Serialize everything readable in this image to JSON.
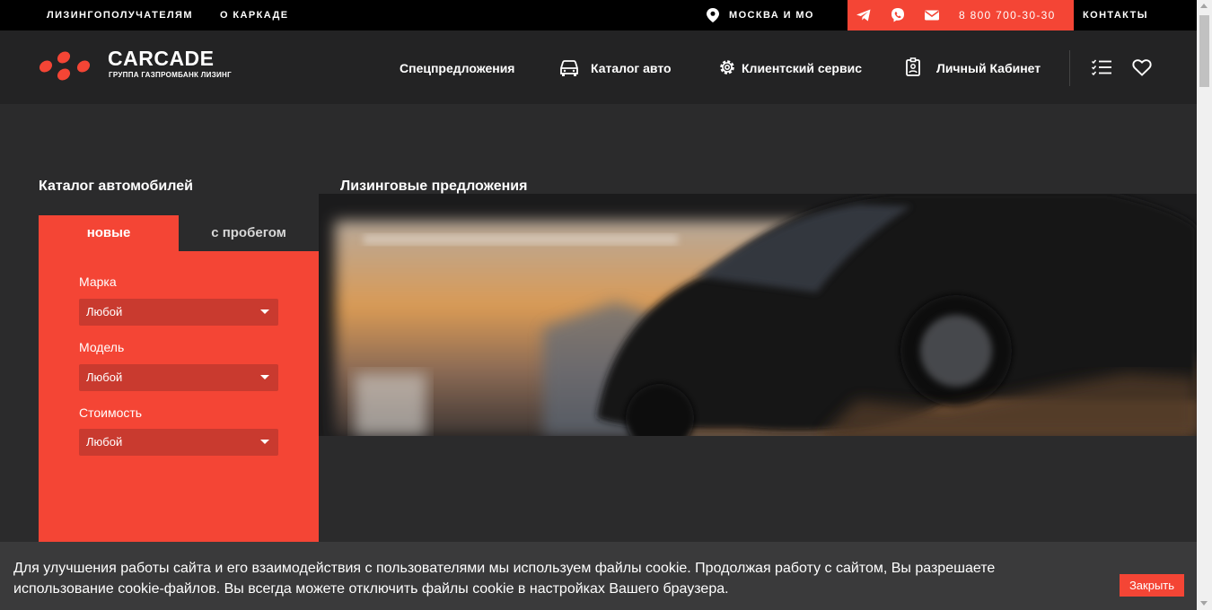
{
  "topbar": {
    "links": [
      "ЛИЗИНГОПОЛУЧАТЕЛЯМ",
      "О КАРКАДЕ"
    ],
    "city": "МОСКВА И МО",
    "phone": "8 800 700-30-30",
    "contacts": "КОНТАКТЫ",
    "icons": [
      "location-pin-icon",
      "telegram-icon",
      "viber-icon",
      "mail-icon"
    ]
  },
  "header": {
    "logo_text": "CARCADE",
    "logo_sub": "ГРУППА ГАЗПРОМБАНК ЛИЗИНГ",
    "nav": {
      "specials": "Спецпредложения",
      "catalog": "Каталог авто",
      "service": "Клиентский сервис",
      "cabinet": "Личный Кабинет"
    },
    "icons": [
      "car-icon",
      "gear-icon",
      "id-badge-icon",
      "compare-list-icon",
      "heart-icon"
    ]
  },
  "main": {
    "catalog_title": "Каталог автомобилей",
    "offers_title": "Лизинговые предложения",
    "tabs": [
      "новые",
      "с пробегом"
    ],
    "filters": [
      {
        "label": "Марка",
        "value": "Любой"
      },
      {
        "label": "Модель",
        "value": "Любой"
      },
      {
        "label": "Стоимость",
        "value": "Любой"
      }
    ]
  },
  "cookie": {
    "text": "Для улучшения работы сайта и его взаимодействия с пользователями мы используем файлы cookie. Продолжая работу с сайтом, Вы разрешаете использование cookie-файлов. Вы всегда можете отключить файлы cookie в настройках Вашего браузера.",
    "button": "Закрыть"
  },
  "colors": {
    "accent": "#f44535",
    "topbar_bg": "#000000",
    "header_bg": "#232324",
    "page_bg": "#2b2b2c"
  }
}
